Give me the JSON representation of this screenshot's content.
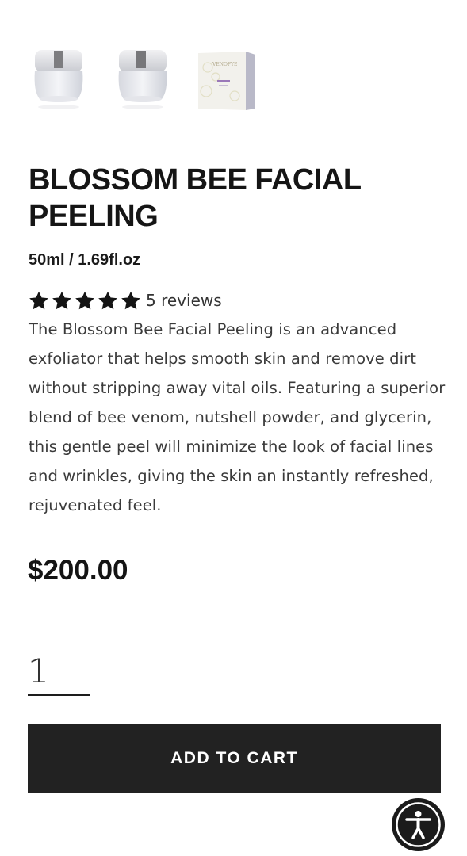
{
  "gallery": {
    "thumbnails": [
      {
        "kind": "jar",
        "label": "jar-front"
      },
      {
        "kind": "jar",
        "label": "jar-angle"
      },
      {
        "kind": "box",
        "label": "product-box",
        "box_brand": "VENOFYE"
      }
    ]
  },
  "product": {
    "title": "BLOSSOM BEE FACIAL PEELING",
    "size": "50ml / 1.69fl.oz",
    "rating": {
      "stars": 5,
      "max": 5,
      "reviews_label": "5 reviews"
    },
    "description": "The Blossom Bee Facial Peeling is an advanced exfoliator that helps smooth skin and remove dirt without stripping away vital oils. Featuring a superior blend of bee venom, nutshell powder, and glycerin, this gentle peel will minimize the look of facial lines and wrinkles, giving the skin an instantly refreshed, rejuvenated feel.",
    "price": "$200.00"
  },
  "cart": {
    "quantity": "1",
    "add_label": "ADD TO CART"
  },
  "accessibility": {
    "icon": "accessibility-icon"
  },
  "colors": {
    "button_bg": "#222222",
    "text": "#1d1d1d"
  }
}
